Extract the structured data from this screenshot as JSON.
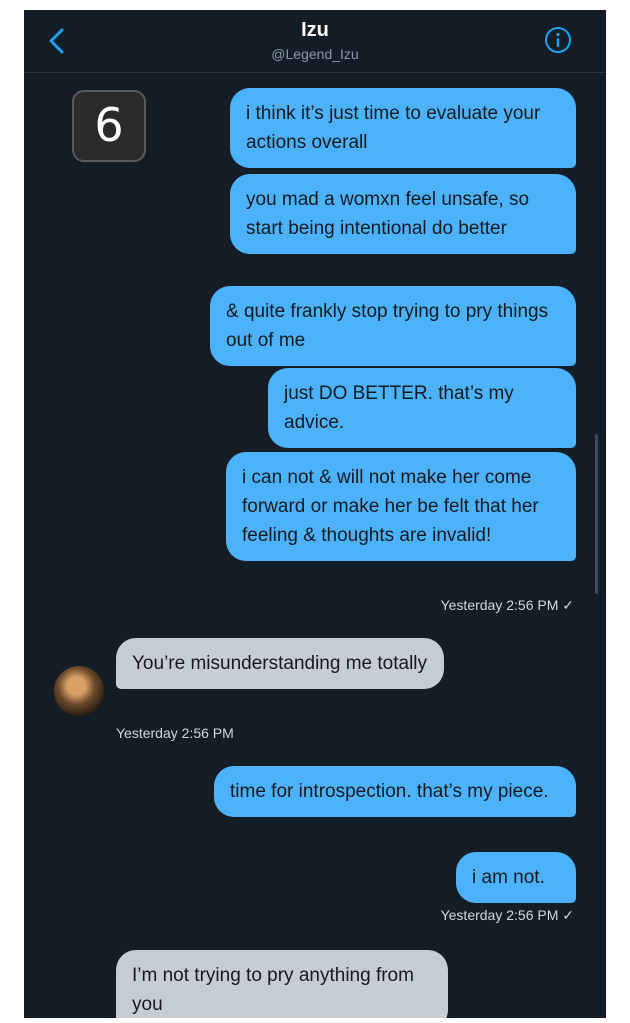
{
  "header": {
    "title": "Izu",
    "handle": "@Legend_Izu",
    "back_icon": "chevron-left-icon",
    "info_icon": "info-icon"
  },
  "badge": {
    "text": "6"
  },
  "messages": [
    {
      "direction": "outgoing",
      "text": "i think it’s just time to evaluate your actions overall"
    },
    {
      "direction": "outgoing",
      "text": "you mad a womxn feel unsafe, so start being intentional do better"
    },
    {
      "direction": "outgoing",
      "text": "& quite frankly stop trying to pry things out of me"
    },
    {
      "direction": "outgoing",
      "text": "just DO BETTER. that’s my advice."
    },
    {
      "direction": "outgoing",
      "text": "i can not & will not make her come forward or make her be felt that her feeling & thoughts are invalid!"
    },
    {
      "direction": "incoming",
      "text": "You’re misunderstanding me totally"
    },
    {
      "direction": "outgoing",
      "text": "time for introspection. that’s my piece."
    },
    {
      "direction": "outgoing",
      "text": "i am not."
    },
    {
      "direction": "incoming",
      "text": "I’m not trying to pry anything from you"
    }
  ],
  "timestamps": {
    "sent_1": "Yesterday 2:56 PM ✓",
    "received_1": "Yesterday 2:56 PM",
    "sent_2": "Yesterday 2:56 PM ✓"
  },
  "colors": {
    "background": "#141d26",
    "outgoing_bubble": "#4cb3fa",
    "incoming_bubble": "#c6cdd3",
    "accent": "#1da1f2"
  }
}
